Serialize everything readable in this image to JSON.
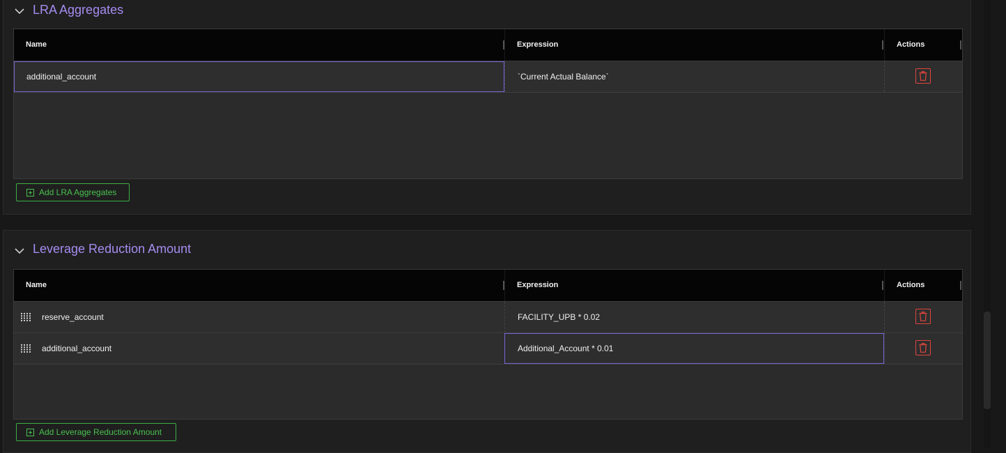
{
  "colors": {
    "accent": "#a58cf0",
    "focus_border": "#7a63d6",
    "add_green": "#49c04f",
    "delete_red": "#e0463c",
    "header_bg": "#050505",
    "row_bg": "#2e2e2e"
  },
  "icons": {
    "collapse": "chevron-down-icon",
    "drag": "drag-handle-icon",
    "delete": "trash-icon",
    "add": "plus-square-icon"
  },
  "lra_aggregates": {
    "title": "LRA Aggregates",
    "columns": {
      "name": "Name",
      "expression": "Expression",
      "actions": "Actions"
    },
    "rows": [
      {
        "name": "additional_account",
        "expression": "`Current Actual Balance`"
      }
    ],
    "add_label": "Add LRA Aggregates"
  },
  "leverage_reduction": {
    "title": "Leverage Reduction Amount",
    "columns": {
      "name": "Name",
      "expression": "Expression",
      "actions": "Actions"
    },
    "rows": [
      {
        "name": "reserve_account",
        "expression": "FACILITY_UPB * 0.02"
      },
      {
        "name": "additional_account",
        "expression": "Additional_Account * 0.01"
      }
    ],
    "add_label": "Add Leverage Reduction Amount"
  }
}
